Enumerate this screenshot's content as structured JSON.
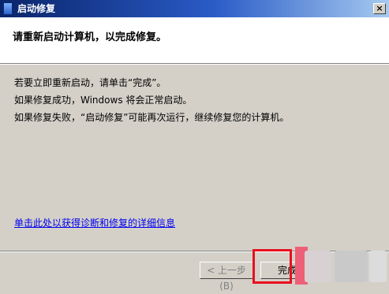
{
  "window": {
    "title": "启动修复",
    "close_label": "×"
  },
  "header": {
    "text": "请重新启动计算机，以完成修复。"
  },
  "body": {
    "lines": [
      "若要立即重新启动，请单击“完成”。",
      "如果修复成功，Windows 将会正常启动。",
      "如果修复失败，“启动修复”可能再次运行，继续修复您的计算机。"
    ],
    "link": "单击此处以获得诊断和修复的详细信息"
  },
  "buttons": {
    "back_label": "< 上一步(B)",
    "finish_label": "完成"
  },
  "colors": {
    "title_bar": "#0a246a",
    "link": "#0000ee",
    "highlight": "#e8101e"
  }
}
